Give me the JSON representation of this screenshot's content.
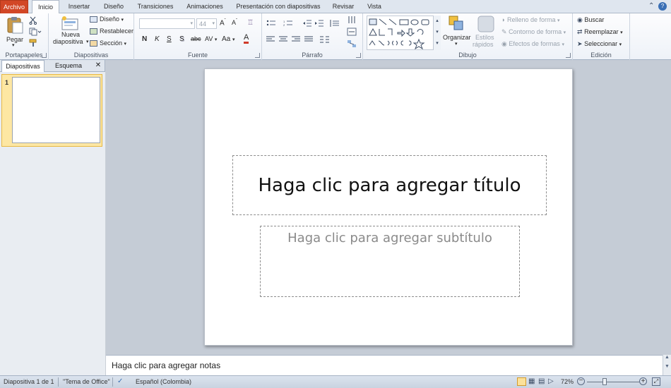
{
  "tabs": [
    "Archivo",
    "Inicio",
    "Insertar",
    "Diseño",
    "Transiciones",
    "Animaciones",
    "Presentación con diapositivas",
    "Revisar",
    "Vista"
  ],
  "ribbon": {
    "portapapeles": {
      "label": "Portapapeles",
      "paste": "Pegar"
    },
    "diapositivas": {
      "label": "Diapositivas",
      "new_slide_1": "Nueva",
      "new_slide_2": "diapositiva",
      "layout": "Diseño",
      "reset": "Restablecer",
      "section": "Sección"
    },
    "fuente": {
      "label": "Fuente",
      "font_name": "",
      "font_size": "44",
      "bold": "N",
      "italic": "K",
      "underline": "S",
      "shadow": "S",
      "strike": "abc",
      "spacing": "AV",
      "case": "Aa",
      "color": "A"
    },
    "parrafo": {
      "label": "Párrafo"
    },
    "dibujo": {
      "label": "Dibujo",
      "arrange": "Organizar",
      "styles_1": "Estilos",
      "styles_2": "rápidos",
      "fill": "Relleno de forma",
      "outline": "Contorno de forma",
      "effects": "Efectos de formas"
    },
    "edicion": {
      "label": "Edición",
      "find": "Buscar",
      "replace": "Reemplazar",
      "select": "Seleccionar"
    }
  },
  "panes": {
    "slides_tab": "Diapositivas",
    "outline_tab": "Esquema",
    "close": "✕",
    "slide_number": "1"
  },
  "slide": {
    "title_placeholder": "Haga clic para agregar título",
    "subtitle_placeholder": "Haga clic para agregar subtítulo"
  },
  "notes": {
    "placeholder": "Haga clic para agregar notas"
  },
  "status": {
    "slide_info": "Diapositiva 1 de 1",
    "theme": "\"Tema de Office\"",
    "language": "Español (Colombia)",
    "zoom": "72%"
  }
}
